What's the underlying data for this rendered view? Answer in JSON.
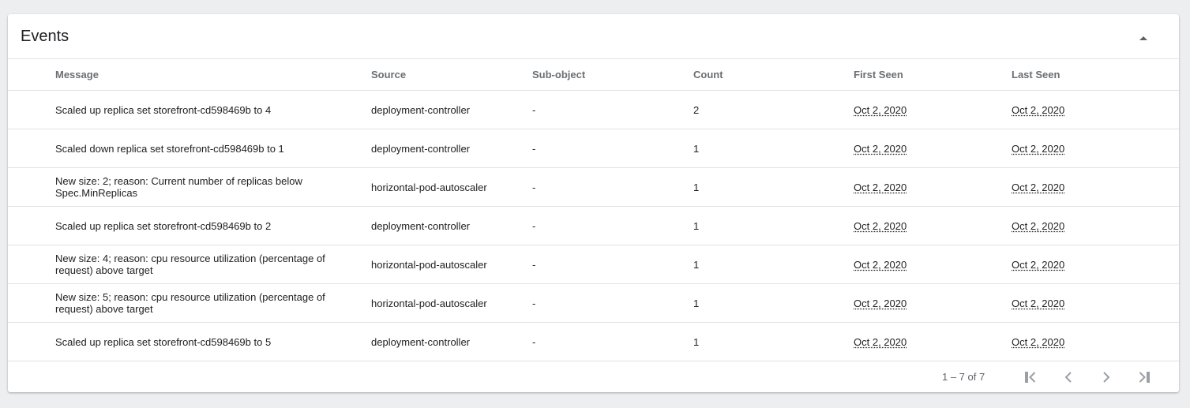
{
  "card": {
    "title": "Events",
    "collapse_icon": "chevron-up-icon"
  },
  "columns": [
    "Message",
    "Source",
    "Sub-object",
    "Count",
    "First Seen",
    "Last Seen"
  ],
  "rows": [
    {
      "message": "Scaled up replica set storefront-cd598469b to 4",
      "source": "deployment-controller",
      "subobject": "-",
      "count": "2",
      "first_seen": "Oct 2, 2020",
      "last_seen": "Oct 2, 2020"
    },
    {
      "message": "Scaled down replica set storefront-cd598469b to 1",
      "source": "deployment-controller",
      "subobject": "-",
      "count": "1",
      "first_seen": "Oct 2, 2020",
      "last_seen": "Oct 2, 2020"
    },
    {
      "message": "New size: 2; reason: Current number of replicas below Spec.MinReplicas",
      "source": "horizontal-pod-autoscaler",
      "subobject": "-",
      "count": "1",
      "first_seen": "Oct 2, 2020",
      "last_seen": "Oct 2, 2020"
    },
    {
      "message": "Scaled up replica set storefront-cd598469b to 2",
      "source": "deployment-controller",
      "subobject": "-",
      "count": "1",
      "first_seen": "Oct 2, 2020",
      "last_seen": "Oct 2, 2020"
    },
    {
      "message": "New size: 4; reason: cpu resource utilization (percentage of request) above target",
      "source": "horizontal-pod-autoscaler",
      "subobject": "-",
      "count": "1",
      "first_seen": "Oct 2, 2020",
      "last_seen": "Oct 2, 2020"
    },
    {
      "message": "New size: 5; reason: cpu resource utilization (percentage of request) above target",
      "source": "horizontal-pod-autoscaler",
      "subobject": "-",
      "count": "1",
      "first_seen": "Oct 2, 2020",
      "last_seen": "Oct 2, 2020"
    },
    {
      "message": "Scaled up replica set storefront-cd598469b to 5",
      "source": "deployment-controller",
      "subobject": "-",
      "count": "1",
      "first_seen": "Oct 2, 2020",
      "last_seen": "Oct 2, 2020"
    }
  ],
  "paginator": {
    "range_label": "1 – 7 of 7",
    "icons": [
      "first-page-icon",
      "previous-page-icon",
      "next-page-icon",
      "last-page-icon"
    ]
  }
}
